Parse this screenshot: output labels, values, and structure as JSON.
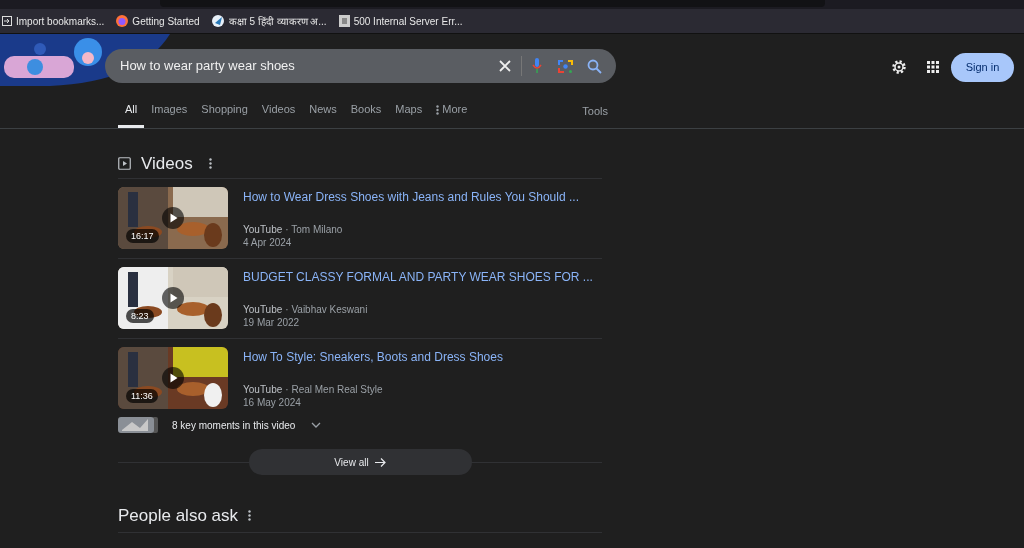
{
  "bookmarks": [
    {
      "label": "Import bookmarks...",
      "kind": "import"
    },
    {
      "label": "Getting Started",
      "kind": "browser"
    },
    {
      "label": "कक्षा 5 हिंदी व्याकरण अ...",
      "kind": "site"
    },
    {
      "label": "500 Internal Server Err...",
      "kind": "page"
    }
  ],
  "search": {
    "value": "How to wear party wear shoes"
  },
  "header": {
    "sign_in": "Sign in"
  },
  "tabs": [
    {
      "label": "All",
      "selected": true
    },
    {
      "label": "Images",
      "selected": false
    },
    {
      "label": "Shopping",
      "selected": false
    },
    {
      "label": "Videos",
      "selected": false
    },
    {
      "label": "News",
      "selected": false
    },
    {
      "label": "Books",
      "selected": false
    },
    {
      "label": "Maps",
      "selected": false
    },
    {
      "label": "More",
      "selected": false
    }
  ],
  "tools": "Tools",
  "videos": {
    "title": "Videos",
    "items": [
      {
        "title": "How to Wear Dress Shoes with Jeans and Rules You Should ...",
        "source": "YouTube",
        "channel": "· Tom Milano",
        "date": "4 Apr 2024",
        "duration": "16:17"
      },
      {
        "title": "BUDGET CLASSY FORMAL AND PARTY WEAR SHOES FOR ...",
        "source": "YouTube",
        "channel": "· Vaibhav Keswani",
        "date": "19 Mar 2022",
        "duration": "8:23"
      },
      {
        "title": "How To Style: Sneakers, Boots and Dress Shoes",
        "source": "YouTube",
        "channel": "· Real Men Real Style",
        "date": "16 May 2024",
        "duration": "11:36"
      }
    ],
    "key_moments": "8 key moments in this video",
    "view_all": "View all"
  },
  "people_also_ask": {
    "title": "People also ask"
  }
}
